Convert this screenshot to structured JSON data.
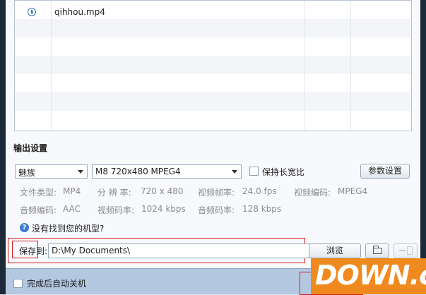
{
  "file_list": {
    "items": [
      {
        "name": "qihhou.mp4",
        "icon": "clock-icon"
      }
    ]
  },
  "output_settings": {
    "title": "输出设置",
    "brand_select": "魅族",
    "model_select": "M8 720x480 MPEG4",
    "keep_ratio_label": "保持长宽比",
    "params_button": "参数设置",
    "info": {
      "file_type_label": "文件类型:",
      "file_type_value": "MP4",
      "resolution_label": "分 辨 率:",
      "resolution_value": "720 x 480",
      "framerate_label": "视频帧率:",
      "framerate_value": "24.0 fps",
      "video_codec_label": "视频编码:",
      "video_codec_value": "MPEG4",
      "audio_codec_label": "音频编码:",
      "audio_codec_value": "AAC",
      "video_bitrate_label": "视频码率:",
      "video_bitrate_value": "1024 kbps",
      "audio_bitrate_label": "音频码率:",
      "audio_bitrate_value": "128 kbps"
    },
    "help_icon": "?",
    "help_text": "没有找到您的机型?"
  },
  "save": {
    "label": "保存到:",
    "path": "D:\\My Documents\\",
    "browse_button": "浏览"
  },
  "bottom": {
    "shutdown_label": "完成后自动关机"
  },
  "watermark": "DOWN.cc",
  "colors": {
    "highlight_box": "#d21f1f",
    "watermark_bg": "#f08a1e"
  }
}
